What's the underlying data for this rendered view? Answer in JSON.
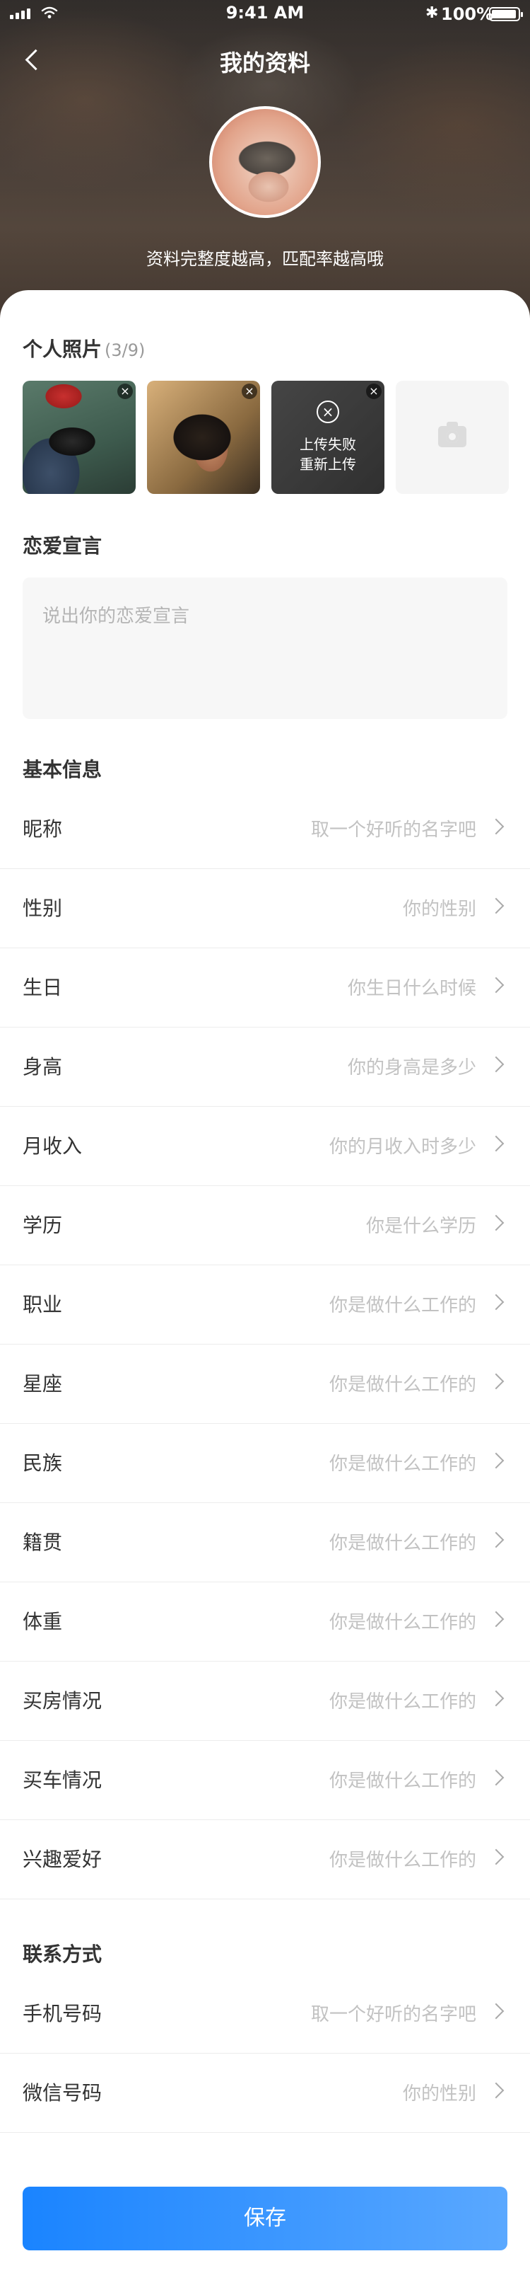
{
  "status_bar": {
    "time": "9:41 AM",
    "battery": "100%"
  },
  "nav": {
    "title": "我的资料"
  },
  "hero": {
    "tip": "资料完整度越高，匹配率越高哦"
  },
  "photos": {
    "title": "个人照片",
    "count": "(3/9)",
    "fail_line1": "上传失败",
    "fail_line2": "重新上传"
  },
  "declaration": {
    "title": "恋爱宣言",
    "placeholder": "说出你的恋爱宣言"
  },
  "basic": {
    "title": "基本信息",
    "rows": [
      {
        "label": "昵称",
        "value": "取一个好听的名字吧"
      },
      {
        "label": "性别",
        "value": "你的性别"
      },
      {
        "label": "生日",
        "value": "你生日什么时候"
      },
      {
        "label": "身高",
        "value": "你的身高是多少"
      },
      {
        "label": "月收入",
        "value": "你的月收入时多少"
      },
      {
        "label": "学历",
        "value": "你是什么学历"
      },
      {
        "label": "职业",
        "value": "你是做什么工作的"
      },
      {
        "label": "星座",
        "value": "你是做什么工作的"
      },
      {
        "label": "民族",
        "value": "你是做什么工作的"
      },
      {
        "label": "籍贯",
        "value": "你是做什么工作的"
      },
      {
        "label": "体重",
        "value": "你是做什么工作的"
      },
      {
        "label": "买房情况",
        "value": "你是做什么工作的"
      },
      {
        "label": "买车情况",
        "value": "你是做什么工作的"
      },
      {
        "label": "兴趣爱好",
        "value": "你是做什么工作的"
      }
    ]
  },
  "contact": {
    "title": "联系方式",
    "rows": [
      {
        "label": "手机号码",
        "value": "取一个好听的名字吧"
      },
      {
        "label": "微信号码",
        "value": "你的性别"
      }
    ]
  },
  "save_label": "保存",
  "colors": {
    "accent": "#1a84ff",
    "placeholder": "#c2c2c2"
  }
}
